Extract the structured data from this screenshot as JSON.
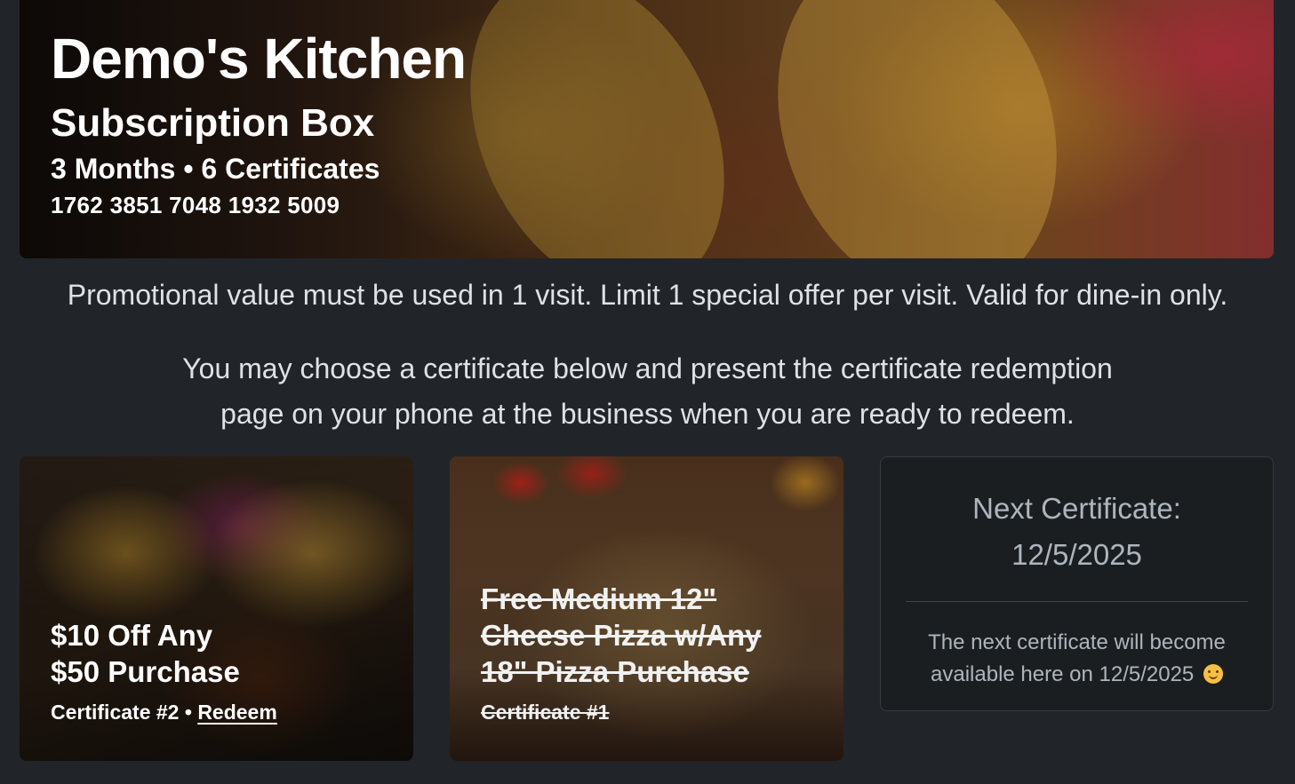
{
  "hero": {
    "title": "Demo's Kitchen",
    "subtitle": "Subscription Box",
    "meta": "3 Months • 6 Certificates",
    "code": "1762 3851 7048 1932 5009",
    "image": "tacos-photo"
  },
  "promo_text": "Promotional value must be used in 1 visit. Limit 1 special offer per visit. Valid for dine-in only.",
  "instructions": {
    "line1": "You may choose a certificate below and present the certificate redemption",
    "line2": "page on your phone at the business when you are ready to redeem."
  },
  "certificates": [
    {
      "title_line1": "$10 Off Any",
      "title_line2": "$50 Purchase",
      "label": "Certificate #2",
      "separator": "•",
      "action": "Redeem",
      "image": "tacos-photo",
      "redeemed": false
    },
    {
      "title_line1": "Free Medium 12\"",
      "title_line2": "Cheese Pizza w/Any",
      "title_line3": "18\" Pizza Purchase",
      "label": "Certificate #1",
      "image": "pizza-photo",
      "redeemed": true
    }
  ],
  "next_certificate": {
    "heading": "Next Certificate:",
    "date": "12/5/2025",
    "note_line1": "The next certificate will become",
    "note_line2": "available here on 12/5/2025",
    "emoji": "smiling-face-icon"
  },
  "colors": {
    "background": "#212529",
    "text": "#dee2e6",
    "muted": "#adb5bd",
    "card_bg": "#1b1e21"
  }
}
